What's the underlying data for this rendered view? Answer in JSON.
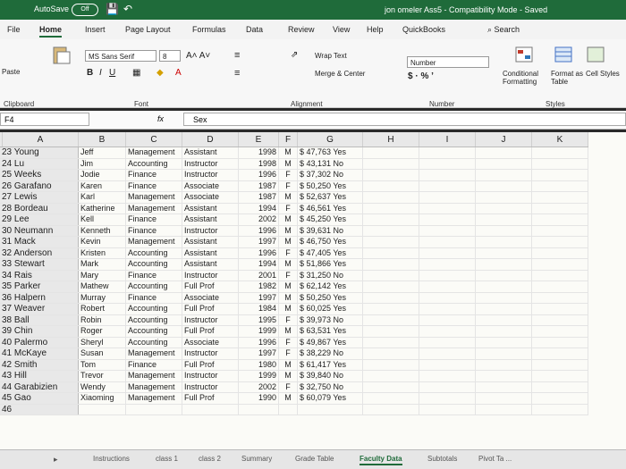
{
  "titlebar": {
    "autosave": "AutoSave",
    "toggle": "Off",
    "document": "jon omeler Ass5 - Compatibility Mode - Saved"
  },
  "tabs": [
    "File",
    "Home",
    "Insert",
    "Page Layout",
    "Formulas",
    "Data",
    "Review",
    "View",
    "Help",
    "QuickBooks"
  ],
  "search_label": "Search",
  "ribbon": {
    "font_name": "MS Sans Serif",
    "font_size": "8",
    "grow_shrink": "A˄ A˅",
    "wrap_text": "Wrap Text",
    "merge_center": "Merge & Center",
    "number_format": "Number",
    "currency": "$ · % ’",
    "conditional_formatting": "Conditional Formatting",
    "format_as_table": "Format as Table",
    "cell_styles": "Cell Styles",
    "paste": "Paste",
    "groups": {
      "clipboard": "Clipboard",
      "font": "Font",
      "alignment": "Alignment",
      "number": "Number",
      "styles": "Styles"
    }
  },
  "formula_bar": {
    "name_box": "F4",
    "fx": "fx",
    "content": "Sex"
  },
  "columns": [
    "A",
    "B",
    "C",
    "D",
    "E",
    "F",
    "G",
    "H",
    "I",
    "J",
    "K"
  ],
  "rows": [
    {
      "n": "23",
      "a": "Young",
      "b": "Jeff",
      "c": "Management",
      "d": "Assistant",
      "e": "1998",
      "f": "M",
      "g": "$ 47,763",
      "g2": "Yes"
    },
    {
      "n": "24",
      "a": "Lu",
      "b": "Jim",
      "c": "Accounting",
      "d": "Instructor",
      "e": "1998",
      "f": "M",
      "g": "$ 43,131",
      "g2": "No"
    },
    {
      "n": "25",
      "a": "Weeks",
      "b": "Jodie",
      "c": "Finance",
      "d": "Instructor",
      "e": "1996",
      "f": "F",
      "g": "$ 37,302",
      "g2": "No"
    },
    {
      "n": "26",
      "a": "Garafano",
      "b": "Karen",
      "c": "Finance",
      "d": "Associate",
      "e": "1987",
      "f": "F",
      "g": "$ 50,250",
      "g2": "Yes"
    },
    {
      "n": "27",
      "a": "Lewis",
      "b": "Karl",
      "c": "Management",
      "d": "Associate",
      "e": "1987",
      "f": "M",
      "g": "$ 52,637",
      "g2": "Yes"
    },
    {
      "n": "28",
      "a": "Bordeau",
      "b": "Katherine",
      "c": "Management",
      "d": "Assistant",
      "e": "1994",
      "f": "F",
      "g": "$ 46,561",
      "g2": "Yes"
    },
    {
      "n": "29",
      "a": "Lee",
      "b": "Kell",
      "c": "Finance",
      "d": "Assistant",
      "e": "2002",
      "f": "M",
      "g": "$ 45,250",
      "g2": "Yes"
    },
    {
      "n": "30",
      "a": "Neumann",
      "b": "Kenneth",
      "c": "Finance",
      "d": "Instructor",
      "e": "1996",
      "f": "M",
      "g": "$ 39,631",
      "g2": "No"
    },
    {
      "n": "31",
      "a": "Mack",
      "b": "Kevin",
      "c": "Management",
      "d": "Assistant",
      "e": "1997",
      "f": "M",
      "g": "$ 46,750",
      "g2": "Yes"
    },
    {
      "n": "32",
      "a": "Anderson",
      "b": "Kristen",
      "c": "Accounting",
      "d": "Assistant",
      "e": "1996",
      "f": "F",
      "g": "$ 47,405",
      "g2": "Yes"
    },
    {
      "n": "33",
      "a": "Stewart",
      "b": "Mark",
      "c": "Accounting",
      "d": "Assistant",
      "e": "1994",
      "f": "M",
      "g": "$ 51,866",
      "g2": "Yes"
    },
    {
      "n": "34",
      "a": "Rais",
      "b": "Mary",
      "c": "Finance",
      "d": "Instructor",
      "e": "2001",
      "f": "F",
      "g": "$ 31,250",
      "g2": "No"
    },
    {
      "n": "35",
      "a": "Parker",
      "b": "Mathew",
      "c": "Accounting",
      "d": "Full Prof",
      "e": "1982",
      "f": "M",
      "g": "$ 62,142",
      "g2": "Yes"
    },
    {
      "n": "36",
      "a": "Halpern",
      "b": "Murray",
      "c": "Finance",
      "d": "Associate",
      "e": "1997",
      "f": "M",
      "g": "$ 50,250",
      "g2": "Yes"
    },
    {
      "n": "37",
      "a": "Weaver",
      "b": "Robert",
      "c": "Accounting",
      "d": "Full Prof",
      "e": "1984",
      "f": "M",
      "g": "$ 60,025",
      "g2": "Yes"
    },
    {
      "n": "38",
      "a": "Ball",
      "b": "Robin",
      "c": "Accounting",
      "d": "Instructor",
      "e": "1995",
      "f": "F",
      "g": "$ 39,973",
      "g2": "No"
    },
    {
      "n": "39",
      "a": "Chin",
      "b": "Roger",
      "c": "Accounting",
      "d": "Full Prof",
      "e": "1999",
      "f": "M",
      "g": "$ 63,531",
      "g2": "Yes"
    },
    {
      "n": "40",
      "a": "Palermo",
      "b": "Sheryl",
      "c": "Accounting",
      "d": "Associate",
      "e": "1996",
      "f": "F",
      "g": "$ 49,867",
      "g2": "Yes"
    },
    {
      "n": "41",
      "a": "McKaye",
      "b": "Susan",
      "c": "Management",
      "d": "Instructor",
      "e": "1997",
      "f": "F",
      "g": "$ 38,229",
      "g2": "No"
    },
    {
      "n": "42",
      "a": "Smith",
      "b": "Tom",
      "c": "Finance",
      "d": "Full Prof",
      "e": "1980",
      "f": "M",
      "g": "$ 61,417",
      "g2": "Yes"
    },
    {
      "n": "43",
      "a": "Hill",
      "b": "Trevor",
      "c": "Management",
      "d": "Instructor",
      "e": "1999",
      "f": "M",
      "g": "$ 39,840",
      "g2": "No"
    },
    {
      "n": "44",
      "a": "Garabizien",
      "b": "Wendy",
      "c": "Management",
      "d": "Instructor",
      "e": "2002",
      "f": "F",
      "g": "$ 32,750",
      "g2": "No"
    },
    {
      "n": "45",
      "a": "Gao",
      "b": "Xiaoming",
      "c": "Management",
      "d": "Full Prof",
      "e": "1990",
      "f": "M",
      "g": "$ 60,079",
      "g2": "Yes"
    },
    {
      "n": "46",
      "a": "",
      "b": "",
      "c": "",
      "d": "",
      "e": "",
      "f": "",
      "g": "",
      "g2": ""
    }
  ],
  "sheet_tabs": [
    "Instructions",
    "class 1",
    "class 2",
    "Summary",
    "Grade Table",
    "Faculty Data",
    "Subtotals",
    "Pivot Ta ..."
  ],
  "active_sheet": "Faculty Data",
  "colors": {
    "excel_green": "#1f6b3a"
  }
}
